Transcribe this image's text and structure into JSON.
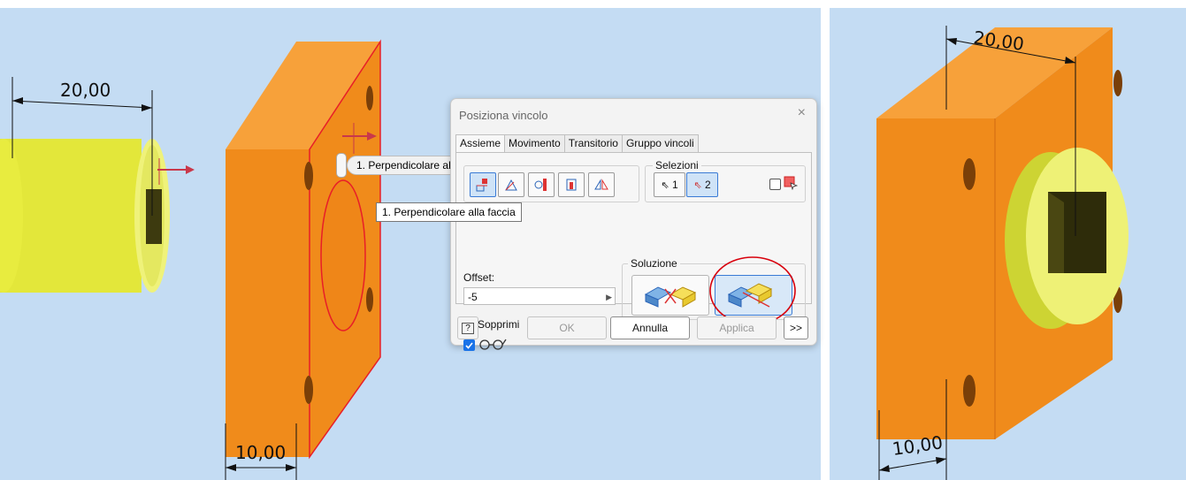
{
  "viewport_left": {
    "dim_top": "20,00",
    "dim_bottom": "10,00"
  },
  "viewport_right": {
    "dim_top": "20,00",
    "dim_bottom": "10,00"
  },
  "glyph_pill": {
    "label": "1. Perpendicolare alla faccia",
    "dropdown_icon": "chevron-down-icon"
  },
  "tooltip": {
    "text": "1. Perpendicolare alla faccia"
  },
  "dialog": {
    "title": "Posiziona vincolo",
    "close_icon": "×",
    "tabs": [
      "Assieme",
      "Movimento",
      "Transitorio",
      "Gruppo vincoli"
    ],
    "active_tab": "Assieme",
    "type_buttons": [
      "mate-icon",
      "angle-icon",
      "tangent-icon",
      "insert-icon",
      "symmetry-icon"
    ],
    "selections": {
      "label": "Selezioni",
      "sel1": "1",
      "sel2": "2",
      "active": "2"
    },
    "offset": {
      "label": "Offset:",
      "value": "-5"
    },
    "solution": {
      "label": "Soluzione",
      "selected": 2
    },
    "sopprimi_label": "Sopprimi",
    "sopprimi_checked": false,
    "preview_checked": true,
    "buttons": {
      "help": "?",
      "ok": "OK",
      "cancel": "Annulla",
      "apply": "Applica",
      "more": ">>"
    }
  },
  "colors": {
    "viewport_bg": "#c4dcf3",
    "orange": "#f28c1c",
    "yellow": "#e3e73a",
    "accent": "#3a7bd5",
    "highlight_circle": "#d8000c"
  }
}
